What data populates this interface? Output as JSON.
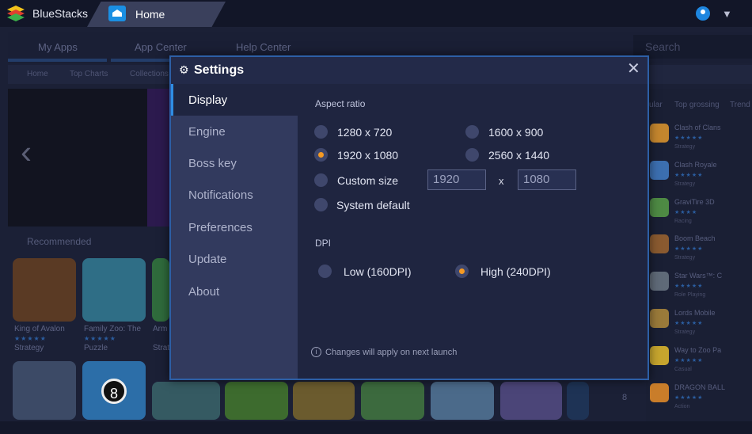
{
  "titlebar": {
    "app_name": "BlueStacks",
    "tab_label": "Home",
    "icons": [
      "bluestacks-logo-icon",
      "home-icon",
      "user-icon",
      "menu-icon"
    ]
  },
  "background": {
    "nav": [
      "My Apps",
      "App Center",
      "Help Center"
    ],
    "search_placeholder": "Search",
    "subnav": [
      "Home",
      "Top Charts",
      "Collections"
    ],
    "recommended_label": "Recommended",
    "tiles": [
      {
        "name": "King of Avalon",
        "genre": "Strategy"
      },
      {
        "name": "Family Zoo: The",
        "genre": "Puzzle"
      },
      {
        "name": "Arm",
        "genre": "Strat"
      }
    ],
    "right_tabs": [
      "ular",
      "Top grossing",
      "Trend"
    ],
    "right_list": [
      {
        "name": "Clash of Clans",
        "cat": "Strategy"
      },
      {
        "name": "Clash Royale",
        "cat": "Strategy"
      },
      {
        "name": "GraviTire 3D",
        "cat": "Racing"
      },
      {
        "name": "Boom Beach",
        "cat": "Strategy"
      },
      {
        "name": "Star Wars™: C",
        "cat": "Role Playing"
      },
      {
        "name": "Lords Mobile",
        "cat": "Strategy"
      },
      {
        "name": "Way to Zoo Pa",
        "cat": "Casual"
      },
      {
        "name": "DRAGON BALL",
        "cat": "Action"
      }
    ],
    "rank_number": "8",
    "tile_number": "8"
  },
  "settings": {
    "title": "Settings",
    "close_glyph": "✕",
    "sidebar": [
      "Display",
      "Engine",
      "Boss key",
      "Notifications",
      "Preferences",
      "Update",
      "About"
    ],
    "active_item": "Display",
    "aspect_ratio_label": "Aspect ratio",
    "resolutions": [
      {
        "label": "1280 x 720",
        "checked": false
      },
      {
        "label": "1600 x 900",
        "checked": false
      },
      {
        "label": "1920 x 1080",
        "checked": true
      },
      {
        "label": "2560 x 1440",
        "checked": false
      }
    ],
    "custom_size_label": "Custom size",
    "custom_width": "1920",
    "custom_height": "1080",
    "custom_x": "x",
    "system_default_label": "System default",
    "dpi_label": "DPI",
    "dpi_options": [
      {
        "label": "Low (160DPI)",
        "checked": false
      },
      {
        "label": "High (240DPI)",
        "checked": true
      }
    ],
    "info_icon_glyph": "i",
    "note": "Changes will apply on next launch"
  },
  "colors": {
    "accent": "#2f8de4",
    "radio_checked": "#f59a23",
    "dialog_bg": "#1f2540",
    "sidebar_bg": "#323a5e"
  }
}
